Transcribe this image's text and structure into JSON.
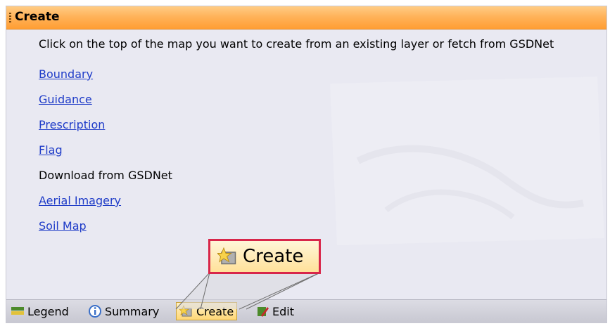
{
  "panel": {
    "title": "Create",
    "instructions": "Click on the top of the map you want to create from an existing layer or fetch from GSDNet",
    "links": [
      {
        "label": "Boundary"
      },
      {
        "label": "Guidance"
      },
      {
        "label": "Prescription"
      },
      {
        "label": "Flag"
      }
    ],
    "download_label": "Download from GSDNet",
    "download_links": [
      {
        "label": "Aerial Imagery"
      },
      {
        "label": "Soil Map"
      }
    ]
  },
  "tabs": [
    {
      "label": "Legend",
      "icon": "legend-icon"
    },
    {
      "label": "Summary",
      "icon": "info-icon"
    },
    {
      "label": "Create",
      "icon": "create-icon",
      "active": true
    },
    {
      "label": "Edit",
      "icon": "edit-icon"
    }
  ],
  "callout": {
    "label": "Create",
    "icon": "create-icon"
  },
  "colors": {
    "header": "#ff9e33",
    "link": "#1f3cc8",
    "callout_border": "#d8264a"
  }
}
